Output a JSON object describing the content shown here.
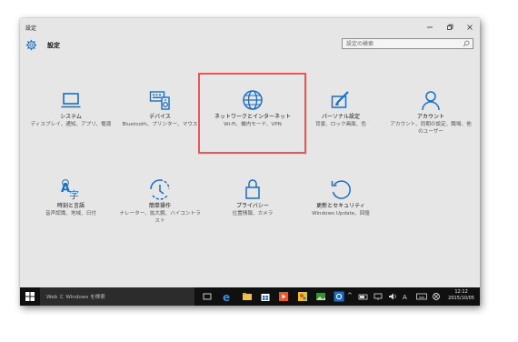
{
  "window": {
    "title": "設定"
  },
  "header": {
    "title": "設定"
  },
  "search": {
    "placeholder": "設定の検索"
  },
  "tiles": [
    {
      "label": "システム",
      "desc": "ディスプレイ、通知、アプリ、電源",
      "icon": "laptop-icon"
    },
    {
      "label": "デバイス",
      "desc": "Bluetooth、プリンター、マウス",
      "icon": "keyboard-speaker-icon"
    },
    {
      "label": "ネットワークとインターネット",
      "desc": "Wi-Fi、機内モード、VPN",
      "icon": "globe-icon"
    },
    {
      "label": "パーソナル設定",
      "desc": "背景、ロック画面、色",
      "icon": "paint-brush-icon"
    },
    {
      "label": "アカウント",
      "desc": "アカウント、同期の設定、職場、他のユーザー",
      "icon": "person-icon"
    },
    {
      "label": "時刻と言語",
      "desc": "音声認識、地域、日付",
      "icon": "time-language-icon"
    },
    {
      "label": "簡単操作",
      "desc": "ナレーター、拡大鏡、ハイコントラスト",
      "icon": "ease-of-access-icon"
    },
    {
      "label": "プライバシー",
      "desc": "位置情報、カメラ",
      "icon": "lock-icon"
    },
    {
      "label": "更新とセキュリティ",
      "desc": "Windows Update、回復",
      "icon": "sync-icon"
    }
  ],
  "taskbar": {
    "search_text": "Web と Windows を検索",
    "time": "12:12",
    "date": "2015/10/05"
  }
}
